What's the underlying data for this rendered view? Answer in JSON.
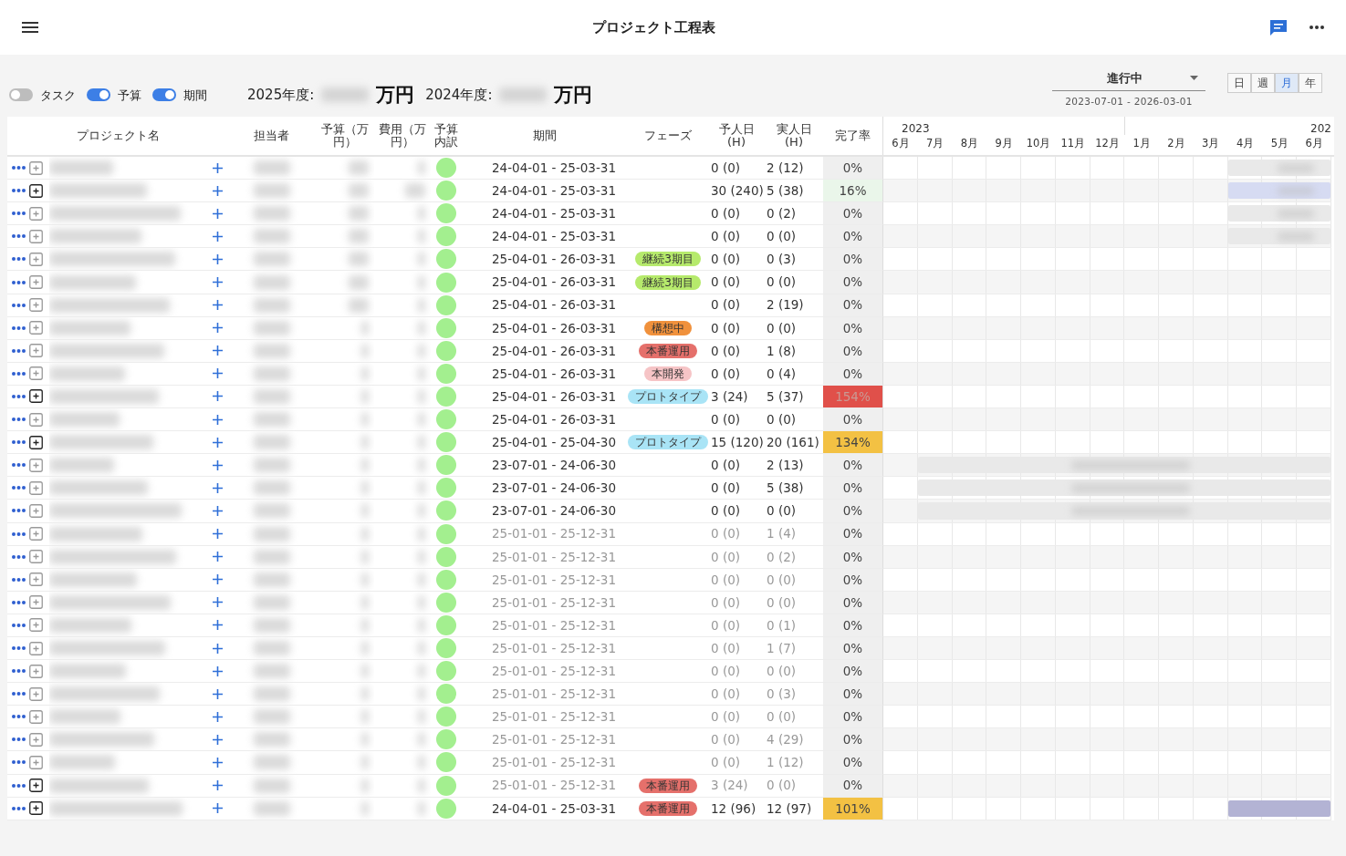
{
  "top_bar": {
    "title": "プロジェクト工程表"
  },
  "toolbar": {
    "toggles": [
      {
        "label": "タスク",
        "on": false
      },
      {
        "label": "予算",
        "on": true
      },
      {
        "label": "期間",
        "on": true
      }
    ],
    "totals": [
      {
        "label": "2025年度:",
        "unit": "万円"
      },
      {
        "label": "2024年度:",
        "unit": "万円"
      }
    ],
    "status_filter": {
      "value": "進行中",
      "range": "2023-07-01 - 2026-03-01"
    },
    "scale_buttons": [
      {
        "label": "日",
        "selected": false
      },
      {
        "label": "週",
        "selected": false
      },
      {
        "label": "月",
        "selected": true
      },
      {
        "label": "年",
        "selected": false
      }
    ]
  },
  "table": {
    "columns": [
      "プロジェクト名",
      "担当者",
      "予算（万円）",
      "費用（万円）",
      "予算内訳",
      "期間",
      "フェーズ",
      "予人日(H)",
      "実人日(H)",
      "完了率"
    ],
    "rows": [
      {
        "has_subtasks": false,
        "muted": false,
        "period": "24-04-01 - 25-03-31",
        "planned": "0 (0)",
        "actual": "2 (12)",
        "rate": {
          "text": "0%",
          "color": "#efefef"
        },
        "gantt_bar": {
          "color": "#e9e9e9"
        }
      },
      {
        "has_subtasks": true,
        "muted": false,
        "period": "24-04-01 - 25-03-31",
        "planned": "30 (240)",
        "actual": "5 (38)",
        "rate": {
          "text": "16%",
          "color": "#eaf6ea"
        },
        "gantt_bar": {
          "color": "#d6dbf2"
        }
      },
      {
        "has_subtasks": false,
        "muted": false,
        "period": "24-04-01 - 25-03-31",
        "planned": "0 (0)",
        "actual": "0 (2)",
        "rate": {
          "text": "0%",
          "color": "#efefef"
        },
        "gantt_bar": {
          "color": "#e9e9e9"
        }
      },
      {
        "has_subtasks": false,
        "muted": false,
        "period": "24-04-01 - 25-03-31",
        "planned": "0 (0)",
        "actual": "0 (0)",
        "rate": {
          "text": "0%",
          "color": "#efefef"
        },
        "gantt_bar": {
          "color": "#e9e9e9"
        }
      },
      {
        "has_subtasks": false,
        "muted": false,
        "period": "25-04-01 - 26-03-31",
        "phase": {
          "label": "継続3期目",
          "color": "#b6ea6c"
        },
        "planned": "0 (0)",
        "actual": "0 (3)",
        "rate": {
          "text": "0%",
          "color": "#efefef"
        }
      },
      {
        "has_subtasks": false,
        "muted": false,
        "period": "25-04-01 - 26-03-31",
        "phase": {
          "label": "継続3期目",
          "color": "#b6ea6c"
        },
        "planned": "0 (0)",
        "actual": "0 (0)",
        "rate": {
          "text": "0%",
          "color": "#efefef"
        }
      },
      {
        "has_subtasks": false,
        "muted": false,
        "period": "25-04-01 - 26-03-31",
        "planned": "0 (0)",
        "actual": "2 (19)",
        "rate": {
          "text": "0%",
          "color": "#efefef"
        }
      },
      {
        "has_subtasks": false,
        "muted": false,
        "period": "25-04-01 - 26-03-31",
        "phase": {
          "label": "構想中",
          "color": "#f0913c"
        },
        "planned": "0 (0)",
        "actual": "0 (0)",
        "rate": {
          "text": "0%",
          "color": "#efefef"
        }
      },
      {
        "has_subtasks": false,
        "muted": false,
        "period": "25-04-01 - 26-03-31",
        "phase": {
          "label": "本番運用",
          "color": "#e5706b"
        },
        "planned": "0 (0)",
        "actual": "1 (8)",
        "rate": {
          "text": "0%",
          "color": "#efefef"
        }
      },
      {
        "has_subtasks": false,
        "muted": false,
        "period": "25-04-01 - 26-03-31",
        "phase": {
          "label": "本開発",
          "color": "#f6c4c6"
        },
        "planned": "0 (0)",
        "actual": "0 (4)",
        "rate": {
          "text": "0%",
          "color": "#efefef"
        }
      },
      {
        "has_subtasks": true,
        "muted": false,
        "period": "25-04-01 - 26-03-31",
        "phase": {
          "label": "プロトタイプ",
          "color": "#a9e4f6"
        },
        "planned": "3 (24)",
        "actual": "5 (37)",
        "rate": {
          "text": "154%",
          "color": "#e0504a"
        }
      },
      {
        "has_subtasks": false,
        "muted": false,
        "period": "25-04-01 - 26-03-31",
        "planned": "0 (0)",
        "actual": "0 (0)",
        "rate": {
          "text": "0%",
          "color": "#efefef"
        }
      },
      {
        "has_subtasks": true,
        "muted": false,
        "period": "25-04-01 - 25-04-30",
        "phase": {
          "label": "プロトタイプ",
          "color": "#a9e4f6"
        },
        "planned": "15 (120)",
        "actual": "20 (161)",
        "rate": {
          "text": "134%",
          "color": "#f3c143"
        }
      },
      {
        "has_subtasks": false,
        "muted": false,
        "period": "23-07-01 - 24-06-30",
        "planned": "0 (0)",
        "actual": "2 (13)",
        "rate": {
          "text": "0%",
          "color": "#efefef"
        },
        "gantt_bar": {
          "color": "#e9e9e9"
        }
      },
      {
        "has_subtasks": false,
        "muted": false,
        "period": "23-07-01 - 24-06-30",
        "planned": "0 (0)",
        "actual": "5 (38)",
        "rate": {
          "text": "0%",
          "color": "#efefef"
        },
        "gantt_bar": {
          "color": "#e9e9e9"
        }
      },
      {
        "has_subtasks": false,
        "muted": false,
        "period": "23-07-01 - 24-06-30",
        "planned": "0 (0)",
        "actual": "0 (0)",
        "rate": {
          "text": "0%",
          "color": "#efefef"
        },
        "gantt_bar": {
          "color": "#e9e9e9"
        }
      },
      {
        "has_subtasks": false,
        "muted": true,
        "period": "25-01-01 - 25-12-31",
        "planned": "0 (0)",
        "actual": "1 (4)",
        "rate": {
          "text": "0%",
          "color": "#efefef"
        }
      },
      {
        "has_subtasks": false,
        "muted": true,
        "period": "25-01-01 - 25-12-31",
        "planned": "0 (0)",
        "actual": "0 (2)",
        "rate": {
          "text": "0%",
          "color": "#efefef"
        }
      },
      {
        "has_subtasks": false,
        "muted": true,
        "period": "25-01-01 - 25-12-31",
        "planned": "0 (0)",
        "actual": "0 (0)",
        "rate": {
          "text": "0%",
          "color": "#efefef"
        }
      },
      {
        "has_subtasks": false,
        "muted": true,
        "period": "25-01-01 - 25-12-31",
        "planned": "0 (0)",
        "actual": "0 (0)",
        "rate": {
          "text": "0%",
          "color": "#efefef"
        }
      },
      {
        "has_subtasks": false,
        "muted": true,
        "period": "25-01-01 - 25-12-31",
        "planned": "0 (0)",
        "actual": "0 (1)",
        "rate": {
          "text": "0%",
          "color": "#efefef"
        }
      },
      {
        "has_subtasks": false,
        "muted": true,
        "period": "25-01-01 - 25-12-31",
        "planned": "0 (0)",
        "actual": "1 (7)",
        "rate": {
          "text": "0%",
          "color": "#efefef"
        }
      },
      {
        "has_subtasks": false,
        "muted": true,
        "period": "25-01-01 - 25-12-31",
        "planned": "0 (0)",
        "actual": "0 (0)",
        "rate": {
          "text": "0%",
          "color": "#efefef"
        }
      },
      {
        "has_subtasks": false,
        "muted": true,
        "period": "25-01-01 - 25-12-31",
        "planned": "0 (0)",
        "actual": "0 (3)",
        "rate": {
          "text": "0%",
          "color": "#efefef"
        }
      },
      {
        "has_subtasks": false,
        "muted": true,
        "period": "25-01-01 - 25-12-31",
        "planned": "0 (0)",
        "actual": "0 (0)",
        "rate": {
          "text": "0%",
          "color": "#efefef"
        }
      },
      {
        "has_subtasks": false,
        "muted": true,
        "period": "25-01-01 - 25-12-31",
        "planned": "0 (0)",
        "actual": "4 (29)",
        "rate": {
          "text": "0%",
          "color": "#efefef"
        }
      },
      {
        "has_subtasks": false,
        "muted": true,
        "period": "25-01-01 - 25-12-31",
        "planned": "0 (0)",
        "actual": "1 (12)",
        "rate": {
          "text": "0%",
          "color": "#efefef"
        }
      },
      {
        "has_subtasks": true,
        "muted": true,
        "period": "25-01-01 - 25-12-31",
        "phase": {
          "label": "本番運用",
          "color": "#e5706b"
        },
        "planned": "3 (24)",
        "actual": "0 (0)",
        "rate": {
          "text": "0%",
          "color": "#efefef"
        }
      },
      {
        "has_subtasks": true,
        "muted": false,
        "period": "24-04-01 - 25-03-31",
        "phase": {
          "label": "本番運用",
          "color": "#e5706b"
        },
        "planned": "12 (96)",
        "actual": "12 (97)",
        "rate": {
          "text": "101%",
          "color": "#f3c143"
        },
        "gantt_bar": {
          "color": "#b3b3d4"
        }
      }
    ]
  },
  "gantt": {
    "years": [
      "2023",
      "202"
    ],
    "months": [
      "6月",
      "7月",
      "8月",
      "9月",
      "10月",
      "11月",
      "12月",
      "1月",
      "2月",
      "3月",
      "4月",
      "5月",
      "6月"
    ]
  }
}
